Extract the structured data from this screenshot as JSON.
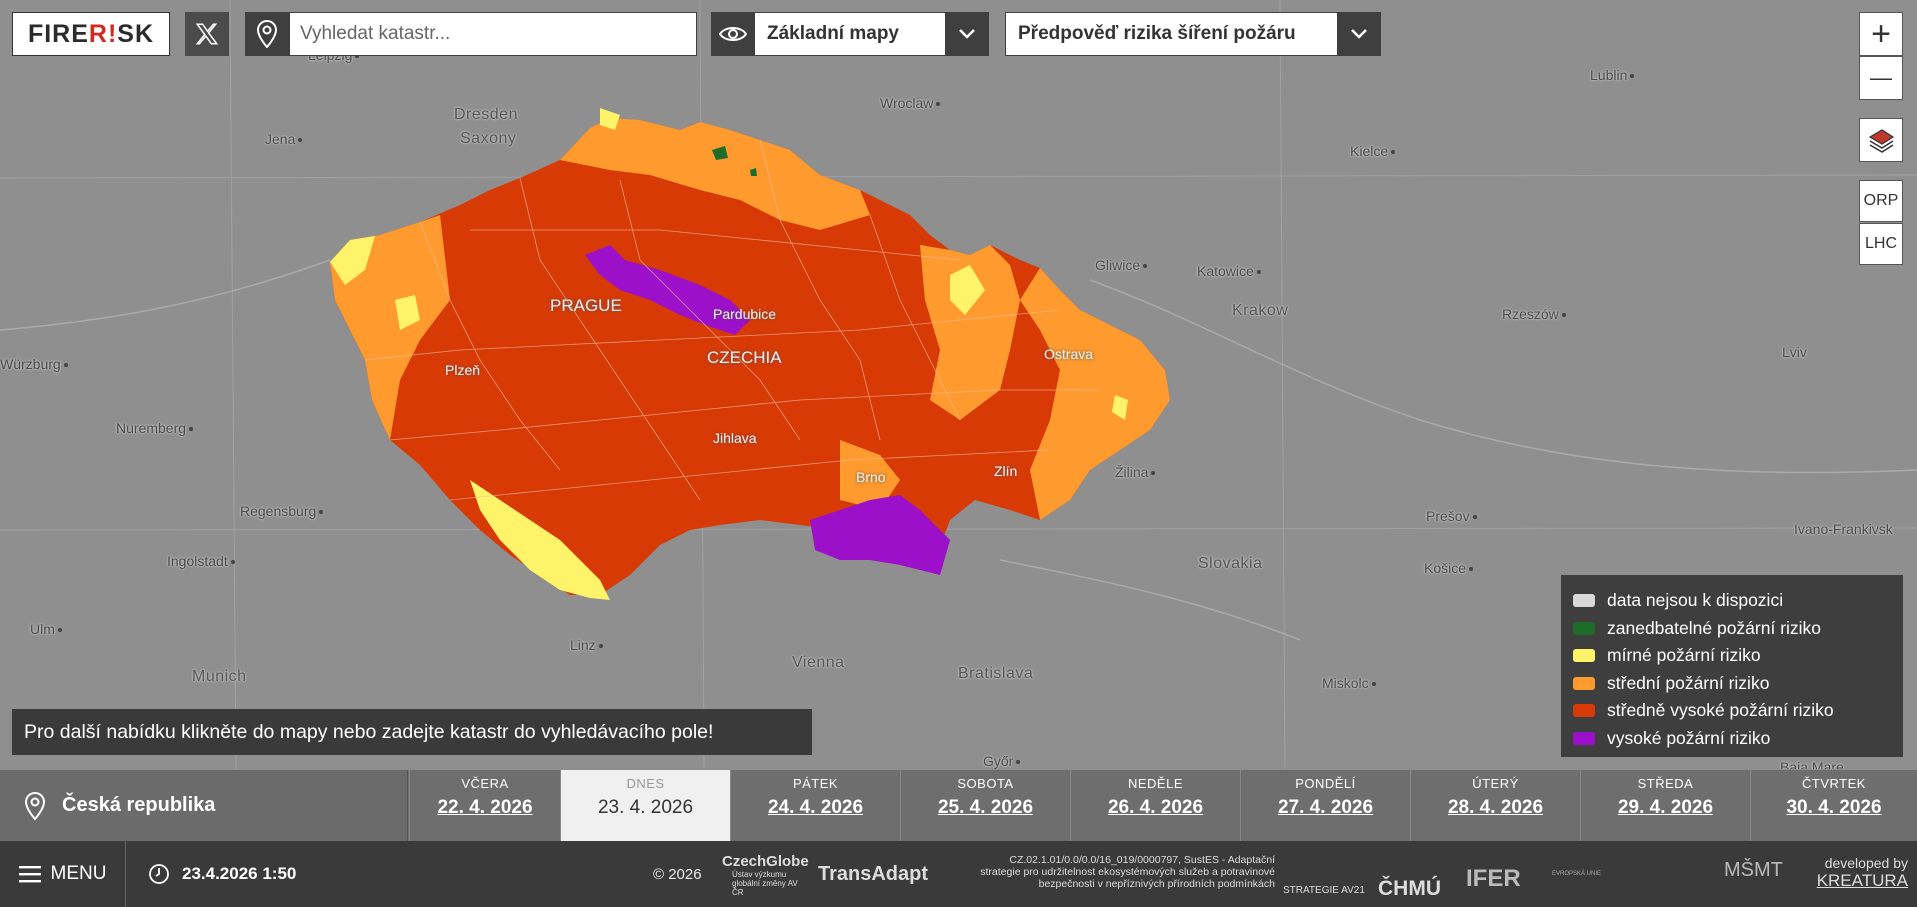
{
  "header": {
    "logo_text_a": "FIRE",
    "logo_text_b": "R!",
    "logo_text_c": "SK",
    "search_placeholder": "Vyhledat katastr...",
    "basemap_value": "Základní mapy",
    "layer_value": "Předpověď rizika šíření požáru"
  },
  "controls": {
    "zoom_in": "+",
    "zoom_out": "—",
    "orp": "ORP",
    "lhc": "LHC"
  },
  "map_labels": {
    "cities": [
      "Leipzig",
      "Jena",
      "Dresden",
      "Saxony",
      "Wroclaw",
      "Lublin",
      "Kielce",
      "Gliwice",
      "Katowice",
      "Krakow",
      "Rzeszów",
      "Lviv",
      "Nuremberg",
      "Regensburg",
      "Ingolstadt",
      "Ulm",
      "Munich",
      "Linz",
      "Vienna",
      "Bratislava",
      "Miskolc",
      "Košice",
      "Prešov",
      "Žilina",
      "Slovakia",
      "Ivano-Frankivsk",
      "Győr",
      "Baia Mare",
      "Würzburg"
    ],
    "country_cities": [
      "PRAGUE",
      "Pardubice",
      "CZECHIA",
      "Plzeň",
      "Jihlava",
      "Brno",
      "Zlín",
      "Ostrava"
    ]
  },
  "legend": {
    "items": [
      {
        "label": "data nejsou k dispozici",
        "color": "#d9d9d9"
      },
      {
        "label": "zanedbatelné požární riziko",
        "color": "#1e6b2a"
      },
      {
        "label": "mírné požární riziko",
        "color": "#fff36a"
      },
      {
        "label": "střední požární riziko",
        "color": "#ff9a2e"
      },
      {
        "label": "středně vysoké požární riziko",
        "color": "#d83a06"
      },
      {
        "label": "vysoké požární riziko",
        "color": "#9b10c8"
      }
    ]
  },
  "hint": "Pro další nabídku klikněte do mapy nebo zadejte katastr do vyhledávacího pole!",
  "location": "Česká republika",
  "days": [
    {
      "name": "VČERA",
      "date": "22. 4. 2026"
    },
    {
      "name": "DNES",
      "date": "23. 4. 2026"
    },
    {
      "name": "PÁTEK",
      "date": "24. 4. 2026"
    },
    {
      "name": "SOBOTA",
      "date": "25. 4. 2026"
    },
    {
      "name": "NEDĚLE",
      "date": "26. 4. 2026"
    },
    {
      "name": "PONDĚLÍ",
      "date": "27. 4. 2026"
    },
    {
      "name": "ÚTERÝ",
      "date": "28. 4. 2026"
    },
    {
      "name": "STŘEDA",
      "date": "29. 4. 2026"
    },
    {
      "name": "ČTVRTEK",
      "date": "30. 4. 2026"
    }
  ],
  "footer": {
    "menu": "MENU",
    "datetime": "23.4.2026 1:50",
    "copyright": "© 2026",
    "czechglobe": "CzechGlobe",
    "czechglobe_sub": "Ústav výzkumu globální změny AV ČR",
    "transadapt": "TransAdapt",
    "project_text": "CZ.02.1.01/0.0/0.0/16_019/0000797, SustES - Adaptační strategie pro udržitelnost ekosystémových služeb a potravinové bezpečnosti v nepříznivých přírodních podmínkách",
    "strategie": "STRATEGIE AV21",
    "chmu": "ČHMÚ",
    "ifer": "IFER",
    "eu": "EVROPSKÁ UNIE",
    "msmt": "MŠMT",
    "developed_by": "developed by",
    "kreatura": "KREATURA"
  }
}
